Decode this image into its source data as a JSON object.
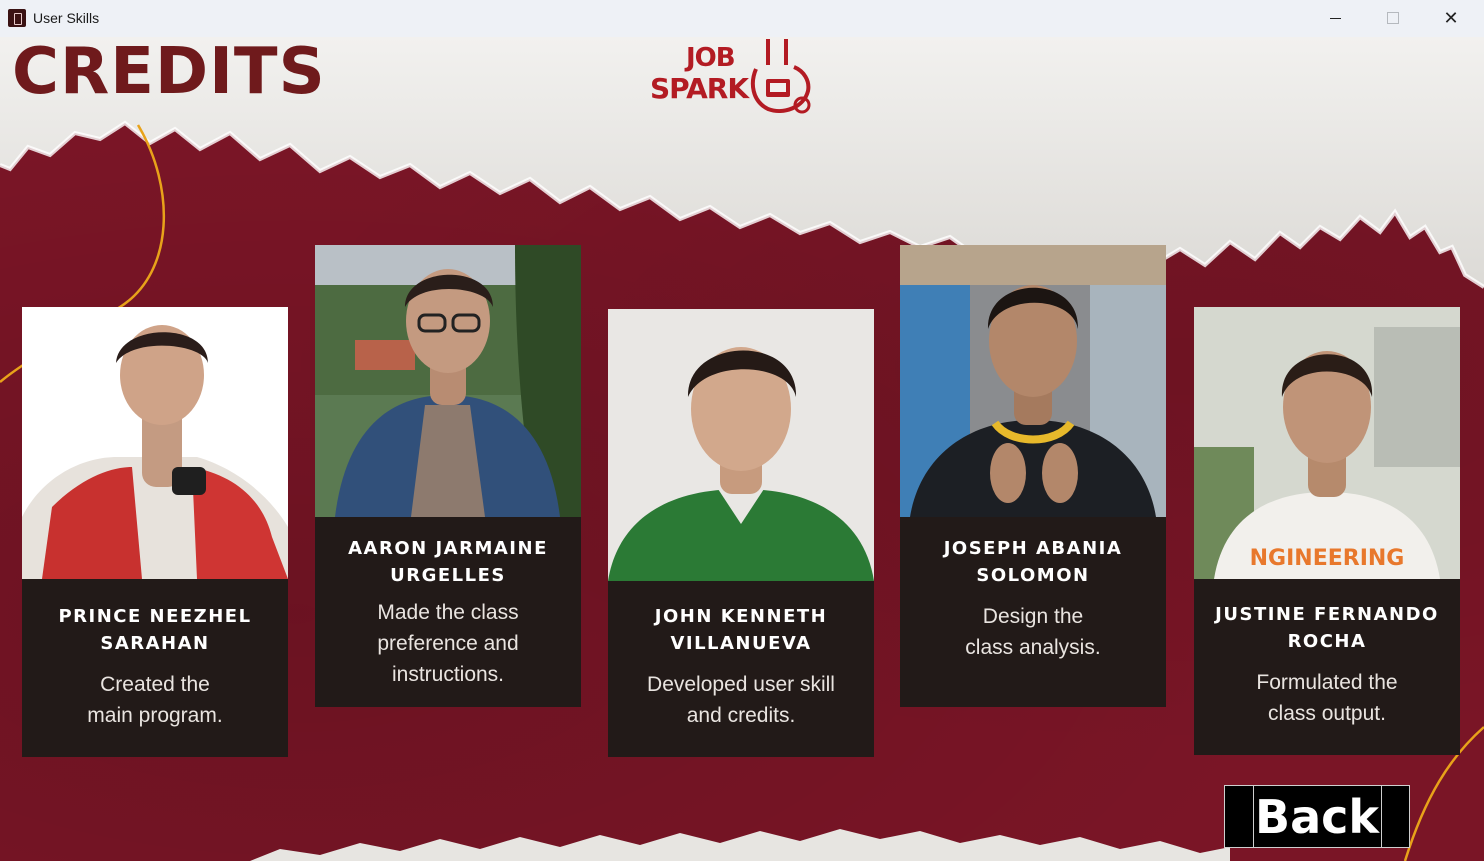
{
  "window": {
    "title": "User Skills",
    "controls": {
      "minimize": "",
      "maximize": "",
      "close": "✕"
    }
  },
  "header": {
    "title": "CREDITS",
    "logo": {
      "line1": "JOB",
      "line2": "SPARK",
      "icon": "job-spark-logo-icon"
    }
  },
  "members": [
    {
      "name": "PRINCE NEEZHEL\nSARAHAN",
      "role": "Created the\nmain program.",
      "photo": "portrait-photo"
    },
    {
      "name": "AARON JARMAINE\nURGELLES",
      "role": "Made the class\npreference and\ninstructions.",
      "photo": "portrait-photo"
    },
    {
      "name": "JOHN KENNETH\nVILLANUEVA",
      "role": "Developed user skill\nand credits.",
      "photo": "portrait-photo"
    },
    {
      "name": "JOSEPH ABANIA\nSOLOMON",
      "role": "Design the\nclass analysis.",
      "photo": "portrait-photo"
    },
    {
      "name": "JUSTINE FERNANDO\nROCHA",
      "role": "Formulated the\nclass output.",
      "photo": "portrait-photo"
    }
  ],
  "back_button": {
    "label": "Back"
  },
  "colors": {
    "background": "#7a1526",
    "paper": "#ecebe8",
    "title": "#6f1a1c",
    "logo": "#b31b23",
    "card": "#221a18",
    "accent_line": "#e8a21a"
  }
}
